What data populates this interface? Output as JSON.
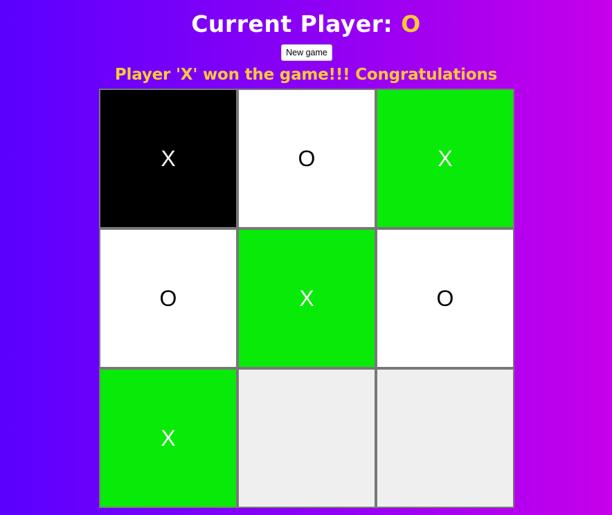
{
  "header": {
    "title_prefix": "Current Player: ",
    "current_player": "O"
  },
  "controls": {
    "new_game_label": "New game"
  },
  "status": {
    "message": "Player 'X' won the game!!! Congratulations"
  },
  "colors": {
    "background_start": "#5a00ff",
    "background_end": "#c600ea",
    "accent": "#ffc83a",
    "win_cell": "#08eb08",
    "last_move_cell": "#000000",
    "filled_cell": "#ffffff",
    "empty_cell": "#efefef"
  },
  "board": {
    "cells": [
      {
        "mark": "X",
        "state": "black"
      },
      {
        "mark": "O",
        "state": "white"
      },
      {
        "mark": "X",
        "state": "green"
      },
      {
        "mark": "O",
        "state": "white"
      },
      {
        "mark": "X",
        "state": "green"
      },
      {
        "mark": "O",
        "state": "white"
      },
      {
        "mark": "X",
        "state": "green"
      },
      {
        "mark": "",
        "state": "empty"
      },
      {
        "mark": "",
        "state": "empty"
      }
    ]
  }
}
